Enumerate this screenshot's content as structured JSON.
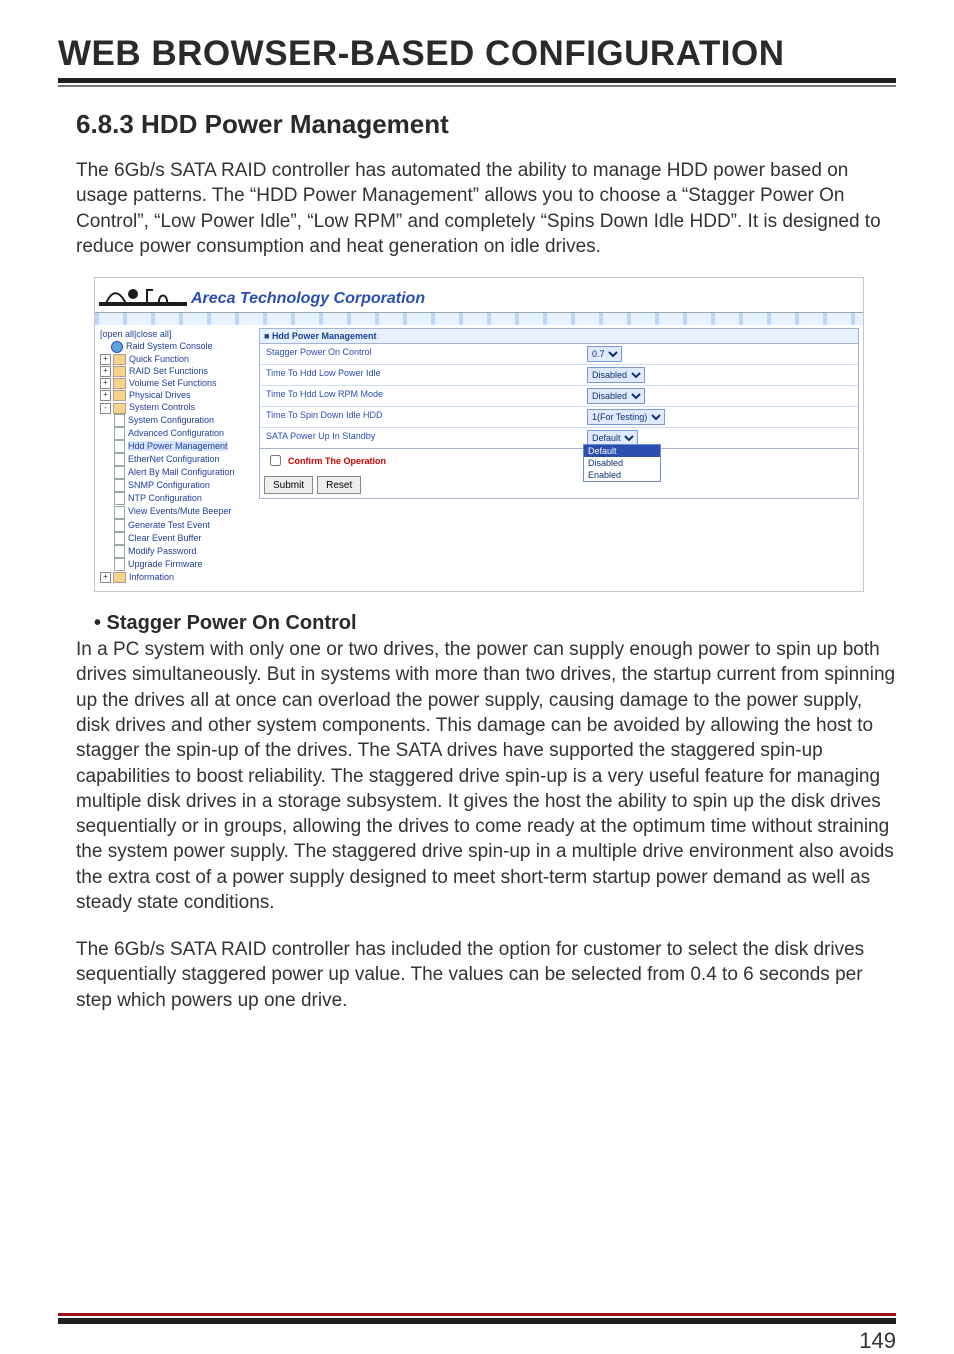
{
  "header_title": "WEB BROWSER-BASED CONFIGURATION",
  "section_number_title": "6.8.3 HDD Power Management",
  "intro_paragraph": "The 6Gb/s SATA RAID controller has automated the ability to manage HDD power based on usage patterns. The “HDD Power Management” allows you to choose a “Stagger Power On Control”, “Low Power Idle”, “Low RPM” and completely “Spins Down Idle HDD”. It is designed to reduce power consumption and heat generation on idle drives.",
  "screenshot": {
    "brand": "Areca Technology Corporation",
    "toggle_label": "[open all|close all]",
    "nav": [
      {
        "lvl": 1,
        "icon": "globe",
        "text": "Raid System Console"
      },
      {
        "lvl": 1,
        "icon": "folder",
        "exp": "+",
        "text": "Quick Function"
      },
      {
        "lvl": 1,
        "icon": "folder",
        "exp": "+",
        "text": "RAID Set Functions"
      },
      {
        "lvl": 1,
        "icon": "folder",
        "exp": "+",
        "text": "Volume Set Functions"
      },
      {
        "lvl": 1,
        "icon": "folder",
        "exp": "+",
        "text": "Physical Drives"
      },
      {
        "lvl": 1,
        "icon": "folder",
        "exp": "-",
        "text": "System Controls"
      },
      {
        "lvl": 2,
        "icon": "page",
        "text": "System Configuration"
      },
      {
        "lvl": 2,
        "icon": "page",
        "text": "Advanced Configuration"
      },
      {
        "lvl": 2,
        "icon": "page",
        "text": "Hdd Power Management",
        "sel": true
      },
      {
        "lvl": 2,
        "icon": "page",
        "text": "EtherNet Configuration"
      },
      {
        "lvl": 2,
        "icon": "page",
        "text": "Alert By Mail Configuration"
      },
      {
        "lvl": 2,
        "icon": "page",
        "text": "SNMP Configuration"
      },
      {
        "lvl": 2,
        "icon": "page",
        "text": "NTP Configuration"
      },
      {
        "lvl": 2,
        "icon": "page",
        "text": "View Events/Mute Beeper"
      },
      {
        "lvl": 2,
        "icon": "page",
        "text": "Generate Test Event"
      },
      {
        "lvl": 2,
        "icon": "page",
        "text": "Clear Event Buffer"
      },
      {
        "lvl": 2,
        "icon": "page",
        "text": "Modify Password"
      },
      {
        "lvl": 2,
        "icon": "page",
        "text": "Upgrade Firmware"
      },
      {
        "lvl": 1,
        "icon": "folder",
        "exp": "+",
        "text": "Information"
      }
    ],
    "panel_title": "Hdd Power Management",
    "rows": [
      {
        "label": "Stagger Power On Control",
        "value": "0.7"
      },
      {
        "label": "Time To Hdd Low Power Idle",
        "value": "Disabled"
      },
      {
        "label": "Time To Hdd Low RPM Mode",
        "value": "Disabled"
      },
      {
        "label": "Time To Spin Down Idle HDD",
        "value": "1(For Testing)"
      },
      {
        "label": "SATA Power Up In Standby",
        "value": "Default",
        "open": true,
        "options": [
          "Default",
          "Disabled",
          "Enabled"
        ]
      }
    ],
    "confirm_label": "Confirm The Operation",
    "buttons": {
      "submit": "Submit",
      "reset": "Reset"
    }
  },
  "bullet_title": "• Stagger Power On Control",
  "bullet_body_1": "In a PC system with only one or two drives, the power can supply enough power to spin up both drives simultaneously. But in systems with more than two drives, the startup current from spinning up the drives all at once can overload the power supply, causing damage to the power supply, disk drives and other system components. This damage can be avoided by allowing the host to stagger the spin-up of the drives. The SATA drives have supported the staggered spin-up capabilities to boost reliability. The staggered drive spin-up is a very useful feature for managing multiple disk drives in a storage subsystem. It gives the host the ability to spin up the disk drives sequentially or in groups, allowing the drives to come ready at the optimum time without straining the system power supply. The staggered drive spin-up in a multiple drive environment also avoids the extra cost of a power supply designed to meet short-term startup power demand as well as steady state conditions.",
  "bullet_body_2": "The 6Gb/s SATA RAID controller has included the option for customer to select the disk drives sequentially staggered power up value. The values can be selected from 0.4 to 6 seconds per step which powers up one drive.",
  "page_number": "149"
}
